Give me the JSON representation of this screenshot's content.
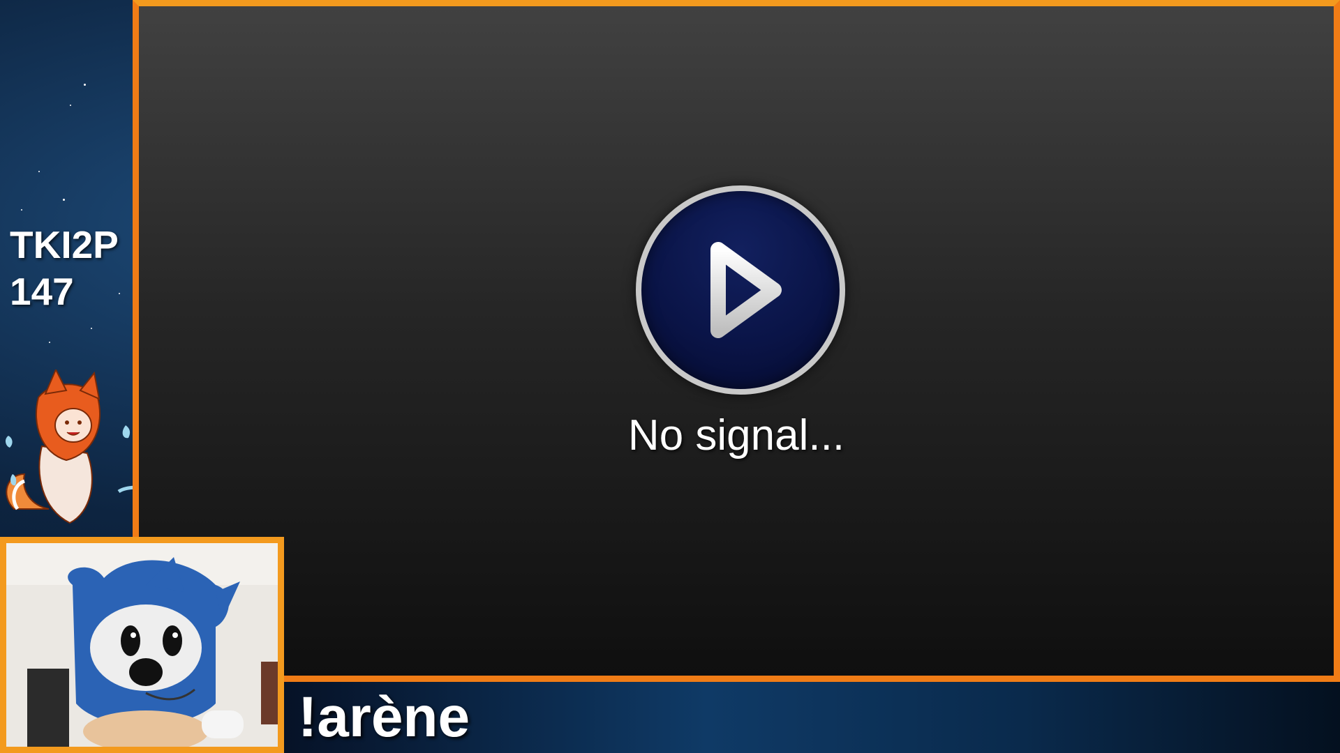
{
  "overlay": {
    "sidebar": {
      "name_line": "TKI2P",
      "number_line": "147"
    },
    "game_area": {
      "status_text": "No signal..."
    },
    "banner": {
      "command_text": "!arène"
    },
    "colors": {
      "frame_orange": "#f07c16",
      "play_button_fill": "#0a1447",
      "play_button_ring": "#c9c9c9"
    },
    "icons": [
      "play-icon",
      "fox-mascot",
      "webcam-plush"
    ]
  }
}
